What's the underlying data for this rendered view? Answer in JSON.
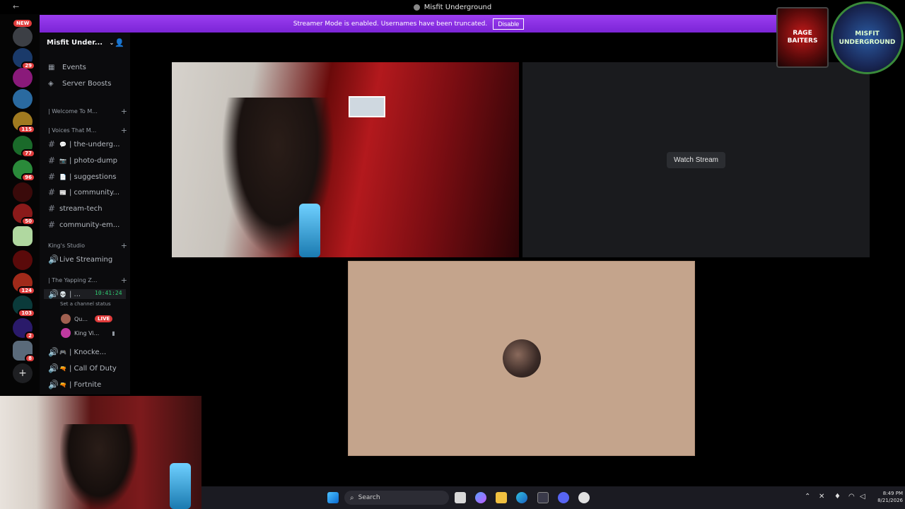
{
  "window": {
    "title": "Misfit Underground",
    "back_label": "←"
  },
  "banner": {
    "message": "Streamer Mode is enabled. Usernames have been truncated.",
    "disable_label": "Disable"
  },
  "server_rail": {
    "new_label": "NEW",
    "badges": [
      "29",
      "115",
      "77",
      "96",
      "50",
      "124",
      "103",
      "2",
      "8"
    ],
    "add_label": "+"
  },
  "server": {
    "name": "Misfit Under...",
    "chevron": "⌄"
  },
  "nav": [
    {
      "label": "Events",
      "icon": "calendar-icon"
    },
    {
      "label": "Server Boosts",
      "icon": "boost-icon"
    }
  ],
  "categories": {
    "welcome": "| Welcome To M...",
    "voices": "| Voices That M...",
    "kings": "King's Studio",
    "yapping": "| The Yapping Z..."
  },
  "text_channels": [
    {
      "label": "| the-underg...",
      "emoji": "💬"
    },
    {
      "label": "| photo-dump",
      "emoji": "📷"
    },
    {
      "label": "| suggestions",
      "emoji": "📄"
    },
    {
      "label": "| community...",
      "emoji": "📰"
    },
    {
      "label": "stream-tech",
      "emoji": ""
    },
    {
      "label": "community-em...",
      "emoji": ""
    }
  ],
  "voice_channels": {
    "live_streaming": "Live Streaming",
    "active_channel": "| ...",
    "call_time": "10:41:24",
    "status_prompt": "Set a channel status",
    "users": [
      {
        "label": "Qu...",
        "live": "LIVE"
      },
      {
        "label": "King Vi...",
        "live": ""
      }
    ],
    "others": [
      {
        "label": "| Knocke..."
      },
      {
        "label": "| Call Of Duty"
      },
      {
        "label": "| Fortnite"
      }
    ]
  },
  "stream_tiles": {
    "watch_label": "Watch Stream"
  },
  "taskbar": {
    "search_label": "Search",
    "time": "8:49 PM",
    "date": "8/21/2026"
  },
  "overlay": {
    "rage_text": "RAGE BAITERS",
    "misfit_text": "MISFIT UNDERGROUND"
  },
  "colors": {
    "banner": "#8a2be2",
    "badge": "#e03c3c",
    "online": "#2ecc71",
    "tile_c": "#c4a48c"
  }
}
